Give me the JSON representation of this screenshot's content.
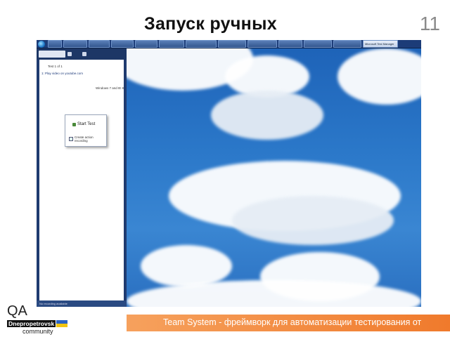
{
  "slide": {
    "title": "Запуск ручных",
    "number": "11"
  },
  "taskbar": {
    "items": [
      "",
      "",
      "",
      "",
      "",
      "",
      "",
      "",
      "",
      "",
      "",
      "",
      "Microsoft Test Manager"
    ]
  },
  "mtm": {
    "tab_label": "",
    "test_counter": "Test 1 of 1",
    "test_title": "1: Play video on youtube.com",
    "environment": "Windows 7 and IE 8",
    "popup": {
      "start_label": "Start Test",
      "create_recording_label": "Create action recording"
    },
    "status": "No recording available"
  },
  "footer": {
    "logo_qa": "QA",
    "logo_city": "Dnepropetrovsk",
    "logo_community": "community",
    "banner_text": "Team System - фреймворк для автоматизации тестирования от"
  },
  "colors": {
    "accent_orange": "#f07a2c",
    "mtm_blue": "#1f3b70",
    "sky_blue": "#2b78c9"
  }
}
